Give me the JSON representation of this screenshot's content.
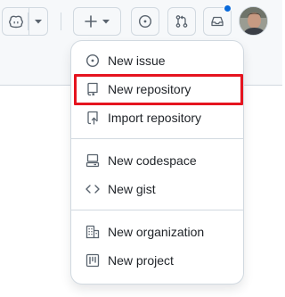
{
  "header": {
    "copilot_icon": "copilot-icon",
    "create_icon": "plus-icon",
    "issues_icon": "issue-opened-icon",
    "pull_requests_icon": "git-pull-request-icon",
    "inbox_icon": "inbox-icon",
    "notification_dot_color": "#0969da"
  },
  "menu": {
    "items": [
      {
        "label": "New issue",
        "icon": "issue-opened-icon"
      },
      {
        "label": "New repository",
        "icon": "repo-icon",
        "highlighted": true
      },
      {
        "label": "Import repository",
        "icon": "repo-push-icon"
      },
      {
        "label": "New codespace",
        "icon": "codespaces-icon"
      },
      {
        "label": "New gist",
        "icon": "code-icon"
      },
      {
        "label": "New organization",
        "icon": "organization-icon"
      },
      {
        "label": "New project",
        "icon": "project-icon"
      }
    ]
  },
  "colors": {
    "highlight": "#e5141f",
    "text": "#1f2328",
    "icon": "#59636e",
    "border": "#d1d9e0"
  }
}
